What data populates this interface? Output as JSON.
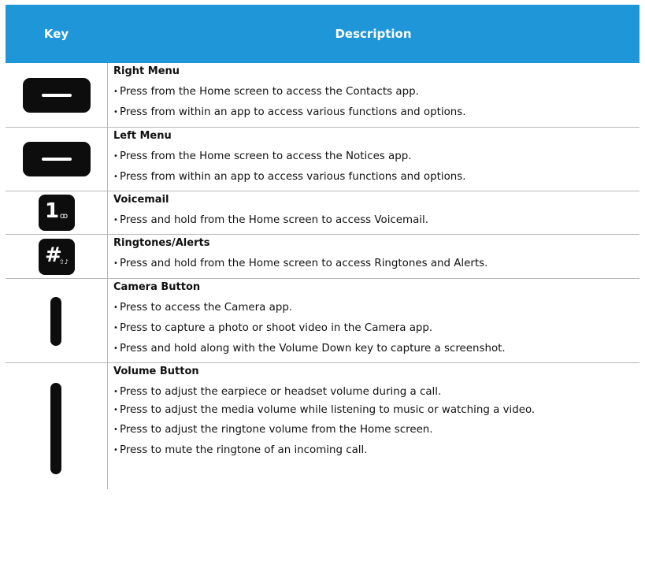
{
  "header": {
    "key": "Key",
    "description": "Description"
  },
  "colors": {
    "header_bg": "#1e96d8",
    "key_bg": "#0d0d0d",
    "grid": "#b9b9b9"
  },
  "rows": [
    {
      "icon": "right-menu-key-icon",
      "title": "Right Menu",
      "bullets": [
        "Press from the Home screen to access the Contacts app.",
        "Press from within an app to access various functions and options."
      ]
    },
    {
      "icon": "left-menu-key-icon",
      "title": "Left Menu",
      "bullets": [
        "Press from the Home screen to access the Notices app.",
        "Press from within an app to access various functions and options."
      ]
    },
    {
      "icon": "voicemail-key-icon",
      "key_glyph": "1",
      "key_sub": "ꝏ",
      "title": "Voicemail",
      "bullets": [
        "Press and hold from the Home screen to access Voicemail."
      ]
    },
    {
      "icon": "ringtones-key-icon",
      "key_glyph": "#",
      "key_sub": "⇧♪",
      "title": "Ringtones/Alerts",
      "bullets": [
        "Press and hold from the Home screen to access Ringtones and Alerts."
      ]
    },
    {
      "icon": "camera-button-icon",
      "title": "Camera Button",
      "bullets": [
        "Press to access the Camera app.",
        "Press to capture a photo or shoot video in the Camera app.",
        "Press and hold along with the Volume Down key to capture a screenshot."
      ]
    },
    {
      "icon": "volume-button-icon",
      "title": "Volume Button",
      "bullets": [
        "Press to adjust the earpiece or headset volume during a call.",
        "Press to adjust the media volume while listening to music or watching a video.",
        "Press to adjust the ringtone volume from the Home screen.",
        "Press to mute the ringtone of an incoming call."
      ]
    }
  ]
}
